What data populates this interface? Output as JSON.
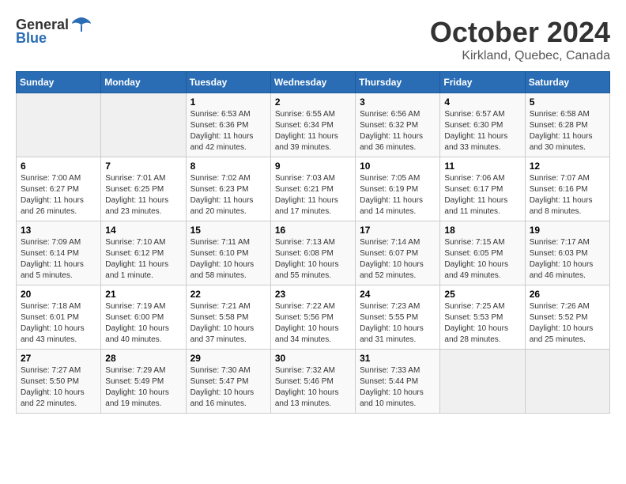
{
  "header": {
    "logo_general": "General",
    "logo_blue": "Blue",
    "month_title": "October 2024",
    "location": "Kirkland, Quebec, Canada"
  },
  "days_of_week": [
    "Sunday",
    "Monday",
    "Tuesday",
    "Wednesday",
    "Thursday",
    "Friday",
    "Saturday"
  ],
  "weeks": [
    [
      {
        "day": "",
        "info": ""
      },
      {
        "day": "",
        "info": ""
      },
      {
        "day": "1",
        "info": "Sunrise: 6:53 AM\nSunset: 6:36 PM\nDaylight: 11 hours and 42 minutes."
      },
      {
        "day": "2",
        "info": "Sunrise: 6:55 AM\nSunset: 6:34 PM\nDaylight: 11 hours and 39 minutes."
      },
      {
        "day": "3",
        "info": "Sunrise: 6:56 AM\nSunset: 6:32 PM\nDaylight: 11 hours and 36 minutes."
      },
      {
        "day": "4",
        "info": "Sunrise: 6:57 AM\nSunset: 6:30 PM\nDaylight: 11 hours and 33 minutes."
      },
      {
        "day": "5",
        "info": "Sunrise: 6:58 AM\nSunset: 6:28 PM\nDaylight: 11 hours and 30 minutes."
      }
    ],
    [
      {
        "day": "6",
        "info": "Sunrise: 7:00 AM\nSunset: 6:27 PM\nDaylight: 11 hours and 26 minutes."
      },
      {
        "day": "7",
        "info": "Sunrise: 7:01 AM\nSunset: 6:25 PM\nDaylight: 11 hours and 23 minutes."
      },
      {
        "day": "8",
        "info": "Sunrise: 7:02 AM\nSunset: 6:23 PM\nDaylight: 11 hours and 20 minutes."
      },
      {
        "day": "9",
        "info": "Sunrise: 7:03 AM\nSunset: 6:21 PM\nDaylight: 11 hours and 17 minutes."
      },
      {
        "day": "10",
        "info": "Sunrise: 7:05 AM\nSunset: 6:19 PM\nDaylight: 11 hours and 14 minutes."
      },
      {
        "day": "11",
        "info": "Sunrise: 7:06 AM\nSunset: 6:17 PM\nDaylight: 11 hours and 11 minutes."
      },
      {
        "day": "12",
        "info": "Sunrise: 7:07 AM\nSunset: 6:16 PM\nDaylight: 11 hours and 8 minutes."
      }
    ],
    [
      {
        "day": "13",
        "info": "Sunrise: 7:09 AM\nSunset: 6:14 PM\nDaylight: 11 hours and 5 minutes."
      },
      {
        "day": "14",
        "info": "Sunrise: 7:10 AM\nSunset: 6:12 PM\nDaylight: 11 hours and 1 minute."
      },
      {
        "day": "15",
        "info": "Sunrise: 7:11 AM\nSunset: 6:10 PM\nDaylight: 10 hours and 58 minutes."
      },
      {
        "day": "16",
        "info": "Sunrise: 7:13 AM\nSunset: 6:08 PM\nDaylight: 10 hours and 55 minutes."
      },
      {
        "day": "17",
        "info": "Sunrise: 7:14 AM\nSunset: 6:07 PM\nDaylight: 10 hours and 52 minutes."
      },
      {
        "day": "18",
        "info": "Sunrise: 7:15 AM\nSunset: 6:05 PM\nDaylight: 10 hours and 49 minutes."
      },
      {
        "day": "19",
        "info": "Sunrise: 7:17 AM\nSunset: 6:03 PM\nDaylight: 10 hours and 46 minutes."
      }
    ],
    [
      {
        "day": "20",
        "info": "Sunrise: 7:18 AM\nSunset: 6:01 PM\nDaylight: 10 hours and 43 minutes."
      },
      {
        "day": "21",
        "info": "Sunrise: 7:19 AM\nSunset: 6:00 PM\nDaylight: 10 hours and 40 minutes."
      },
      {
        "day": "22",
        "info": "Sunrise: 7:21 AM\nSunset: 5:58 PM\nDaylight: 10 hours and 37 minutes."
      },
      {
        "day": "23",
        "info": "Sunrise: 7:22 AM\nSunset: 5:56 PM\nDaylight: 10 hours and 34 minutes."
      },
      {
        "day": "24",
        "info": "Sunrise: 7:23 AM\nSunset: 5:55 PM\nDaylight: 10 hours and 31 minutes."
      },
      {
        "day": "25",
        "info": "Sunrise: 7:25 AM\nSunset: 5:53 PM\nDaylight: 10 hours and 28 minutes."
      },
      {
        "day": "26",
        "info": "Sunrise: 7:26 AM\nSunset: 5:52 PM\nDaylight: 10 hours and 25 minutes."
      }
    ],
    [
      {
        "day": "27",
        "info": "Sunrise: 7:27 AM\nSunset: 5:50 PM\nDaylight: 10 hours and 22 minutes."
      },
      {
        "day": "28",
        "info": "Sunrise: 7:29 AM\nSunset: 5:49 PM\nDaylight: 10 hours and 19 minutes."
      },
      {
        "day": "29",
        "info": "Sunrise: 7:30 AM\nSunset: 5:47 PM\nDaylight: 10 hours and 16 minutes."
      },
      {
        "day": "30",
        "info": "Sunrise: 7:32 AM\nSunset: 5:46 PM\nDaylight: 10 hours and 13 minutes."
      },
      {
        "day": "31",
        "info": "Sunrise: 7:33 AM\nSunset: 5:44 PM\nDaylight: 10 hours and 10 minutes."
      },
      {
        "day": "",
        "info": ""
      },
      {
        "day": "",
        "info": ""
      }
    ]
  ]
}
